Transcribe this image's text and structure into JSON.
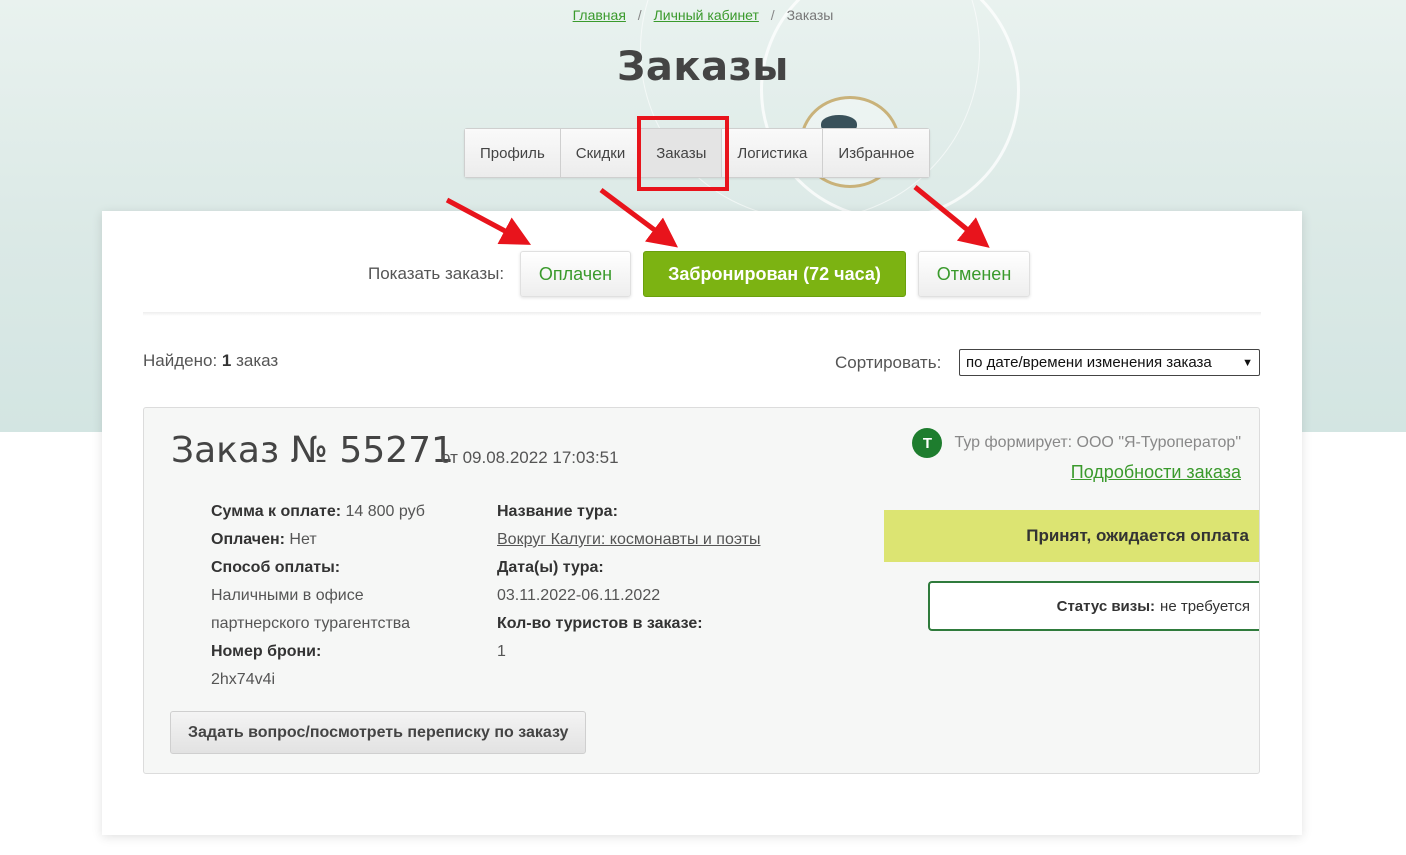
{
  "breadcrumb": {
    "home": "Главная",
    "separator": "/",
    "account": "Личный кабинет",
    "current": "Заказы"
  },
  "page_title": "Заказы",
  "tabs": [
    {
      "label": "Профиль"
    },
    {
      "label": "Скидки"
    },
    {
      "label": "Заказы",
      "active": true
    },
    {
      "label": "Логистика"
    },
    {
      "label": "Избранное"
    }
  ],
  "filters": {
    "label": "Показать заказы:",
    "paid": "Оплачен",
    "booked": "Забронирован (72 часа)",
    "cancelled": "Отменен"
  },
  "results": {
    "found_label": "Найдено:",
    "count": "1",
    "unit": "заказ"
  },
  "sort": {
    "label": "Сортировать:",
    "selected": "по дате/времени изменения заказа"
  },
  "order": {
    "title": "Заказ № 55271",
    "date": "от 09.08.2022 17:03:51",
    "operator_initial": "Т",
    "operator": "Тур формирует: ООО \"Я-Туроператор\"",
    "details_link": "Подробности заказа",
    "status": "Принят, ожидается оплата",
    "visa_label": "Статус визы:",
    "visa_value": "не требуется",
    "amount_label": "Сумма к оплате:",
    "amount_value": "14 800 руб",
    "paid_label": "Оплачен:",
    "paid_value": "Нет",
    "payment_label": "Способ оплаты:",
    "payment_line1": "Наличными в офисе",
    "payment_line2": "партнерского турагентства",
    "booking_label": "Номер брони:",
    "booking_value": "2hx74v4i",
    "tour_name_label": "Название тура:",
    "tour_name": "Вокруг Калуги: космонавты и поэты",
    "tour_dates_label": "Дата(ы) тура:",
    "tour_dates": "03.11.2022-06.11.2022",
    "tourists_label": "Кол-во туристов в заказе:",
    "tourists_value": "1",
    "ask_button": "Задать вопрос/посмотреть переписку по заказу"
  },
  "colors": {
    "accent_green": "#3a9a2c",
    "primary_button": "#7cb312",
    "status_bar": "#dce472",
    "operator_badge": "#1e7d2e",
    "annotation_red": "#e8141c"
  }
}
